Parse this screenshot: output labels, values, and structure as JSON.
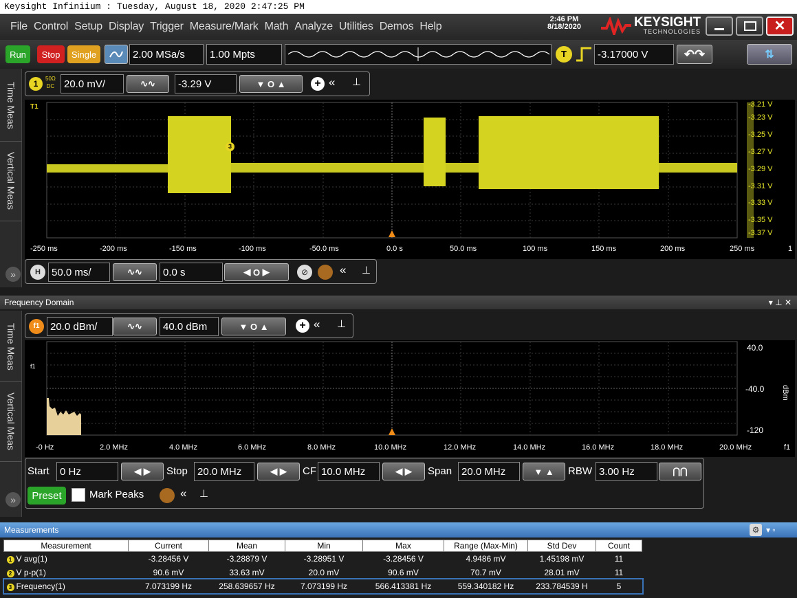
{
  "window_title": "Keysight Infiniium : Tuesday, August 18, 2020 2:47:25 PM",
  "menu": [
    "File",
    "Control",
    "Setup",
    "Display",
    "Trigger",
    "Measure/Mark",
    "Math",
    "Analyze",
    "Utilities",
    "Demos",
    "Help"
  ],
  "clock": {
    "time": "2:46 PM",
    "date": "8/18/2020"
  },
  "brand": {
    "name": "KEYSIGHT",
    "sub": "TECHNOLOGIES"
  },
  "toolbar": {
    "run": "Run",
    "stop": "Stop",
    "single": "Single",
    "sample_rate": "2.00 MSa/s",
    "memory": "1.00 Mpts",
    "trigger_badge": "T",
    "trigger_level": "-3.17000 V"
  },
  "side_tabs": {
    "time_meas": "Time Meas",
    "vertical_meas": "Vertical Meas"
  },
  "channel1": {
    "badge": "1",
    "coupling_top": "50Ω",
    "coupling_bottom": "DC",
    "scale": "20.0 mV/",
    "offset": "-3.29 V"
  },
  "time_plot": {
    "x_ticks": [
      "-250 ms",
      "-200 ms",
      "-150 ms",
      "-100 ms",
      "-50.0 ms",
      "0.0 s",
      "50.0 ms",
      "100 ms",
      "150 ms",
      "200 ms",
      "250 ms"
    ],
    "y_ticks": [
      "-3.21 V",
      "-3.23 V",
      "-3.25 V",
      "-3.27 V",
      "-3.29 V",
      "-3.31 V",
      "-3.33 V",
      "-3.35 V",
      "-3.37 V"
    ],
    "ref_marker": "T1",
    "marker3": "3",
    "right_edge_label": "1"
  },
  "horizontal": {
    "badge": "H",
    "scale": "50.0 ms/",
    "position": "0.0 s"
  },
  "freq_panel": {
    "title": "Frequency Domain",
    "f1_badge": "f1",
    "scale": "20.0 dBm/",
    "offset": "40.0 dBm",
    "x_ticks": [
      "-0 Hz",
      "2.0 MHz",
      "4.0 MHz",
      "6.0 MHz",
      "8.0 MHz",
      "10.0 MHz",
      "12.0 MHz",
      "14.0 MHz",
      "16.0 MHz",
      "18.0 MHz",
      "20.0 MHz"
    ],
    "y_ticks": [
      "40.0",
      "-40.0",
      "-120"
    ],
    "y_unit": "dBm",
    "right_edge_label": "f1",
    "marker_label": "f1",
    "start_label": "Start",
    "start": "0 Hz",
    "stop_label": "Stop",
    "stop": "20.0 MHz",
    "cf_label": "CF",
    "cf": "10.0 MHz",
    "span_label": "Span",
    "span": "20.0 MHz",
    "rbw_label": "RBW",
    "rbw": "3.00 Hz",
    "preset": "Preset",
    "mark_peaks": "Mark Peaks"
  },
  "measurements": {
    "title": "Measurements",
    "columns": [
      "Measurement",
      "Current",
      "Mean",
      "Min",
      "Max",
      "Range (Max-Min)",
      "Std Dev",
      "Count"
    ],
    "rows": [
      {
        "badge": "1",
        "name": "V avg(1)",
        "current": "-3.28456 V",
        "mean": "-3.28879 V",
        "min": "-3.28951 V",
        "max": "-3.28456 V",
        "range": "4.9486 mV",
        "std": "1.45198 mV",
        "count": "11"
      },
      {
        "badge": "2",
        "name": "V p-p(1)",
        "current": "90.6 mV",
        "mean": "33.63 mV",
        "min": "20.0 mV",
        "max": "90.6 mV",
        "range": "70.7 mV",
        "std": "28.01 mV",
        "count": "11"
      },
      {
        "badge": "3",
        "name": "Frequency(1)",
        "current": "7.073199 Hz",
        "mean": "258.639657 Hz",
        "min": "7.073199 Hz",
        "max": "566.413381 Hz",
        "range": "559.340182 Hz",
        "std": "233.784539 H",
        "count": "5"
      }
    ]
  },
  "colors": {
    "trace": "#e6e62a",
    "spectrum": "#e8d09a",
    "run": "#2aa52a",
    "stop": "#d02020",
    "single": "#e0a020",
    "accent": "#f08c1a"
  }
}
